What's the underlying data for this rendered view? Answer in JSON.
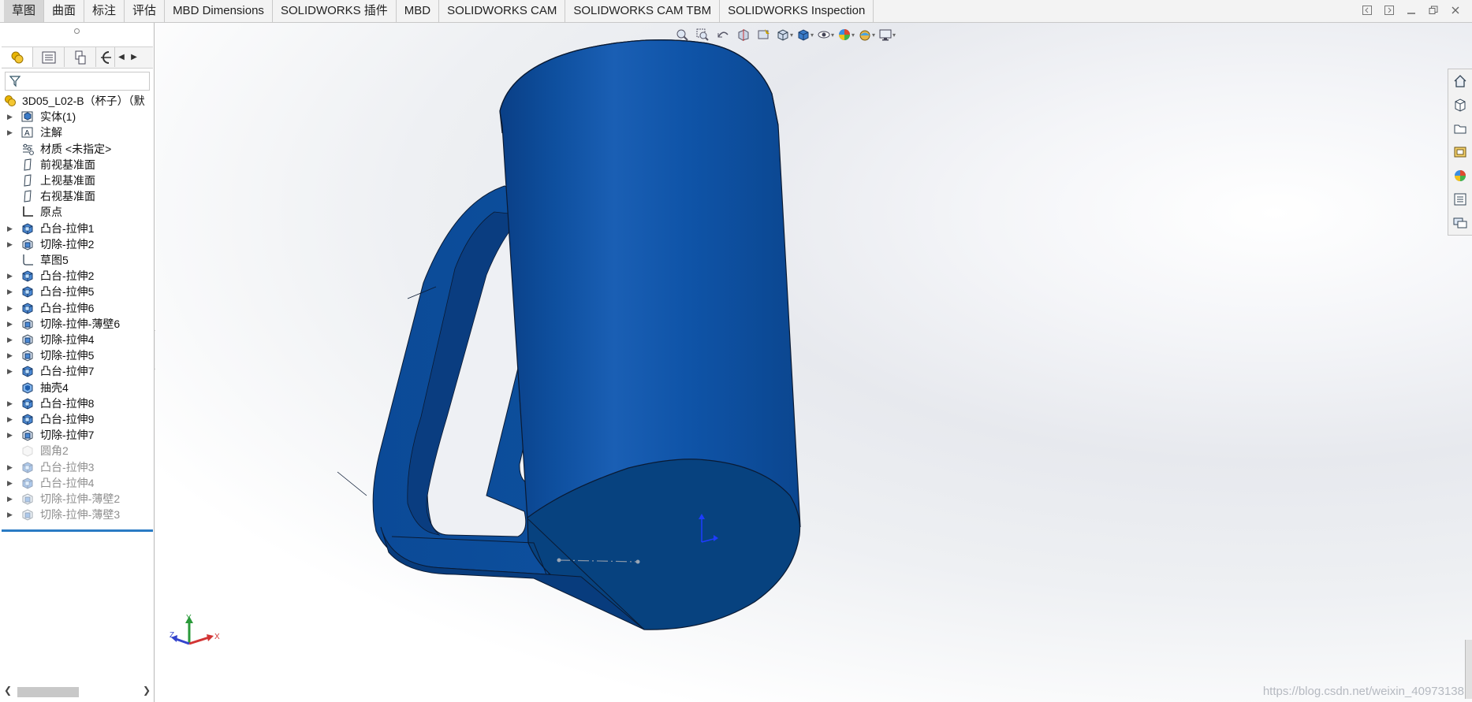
{
  "tabs": [
    {
      "label": "草图",
      "active": true
    },
    {
      "label": "曲面"
    },
    {
      "label": "标注"
    },
    {
      "label": "评估"
    },
    {
      "label": "MBD Dimensions"
    },
    {
      "label": "SOLIDWORKS 插件"
    },
    {
      "label": "MBD"
    },
    {
      "label": "SOLIDWORKS CAM"
    },
    {
      "label": "SOLIDWORKS CAM TBM"
    },
    {
      "label": "SOLIDWORKS Inspection"
    }
  ],
  "feature_tree": {
    "root": "3D05_L02-B（杯子）（默",
    "items": [
      {
        "label": "实体(1)",
        "icon": "solid-bodies-icon",
        "expandable": true
      },
      {
        "label": "注解",
        "icon": "annotations-icon",
        "expandable": true
      },
      {
        "label": "材质 <未指定>",
        "icon": "material-icon",
        "expandable": false
      },
      {
        "label": "前视基准面",
        "icon": "plane-icon",
        "expandable": false
      },
      {
        "label": "上视基准面",
        "icon": "plane-icon",
        "expandable": false
      },
      {
        "label": "右视基准面",
        "icon": "plane-icon",
        "expandable": false
      },
      {
        "label": "原点",
        "icon": "origin-icon",
        "expandable": false
      },
      {
        "label": "凸台-拉伸1",
        "icon": "boss-extrude-icon",
        "expandable": true
      },
      {
        "label": "切除-拉伸2",
        "icon": "cut-extrude-icon",
        "expandable": true
      },
      {
        "label": "草图5",
        "icon": "sketch-icon",
        "expandable": false
      },
      {
        "label": "凸台-拉伸2",
        "icon": "boss-extrude-icon",
        "expandable": true
      },
      {
        "label": "凸台-拉伸5",
        "icon": "boss-extrude-icon",
        "expandable": true
      },
      {
        "label": "凸台-拉伸6",
        "icon": "boss-extrude-icon",
        "expandable": true
      },
      {
        "label": "切除-拉伸-薄壁6",
        "icon": "cut-extrude-icon",
        "expandable": true
      },
      {
        "label": "切除-拉伸4",
        "icon": "cut-extrude-icon",
        "expandable": true
      },
      {
        "label": "切除-拉伸5",
        "icon": "cut-extrude-icon",
        "expandable": true
      },
      {
        "label": "凸台-拉伸7",
        "icon": "boss-extrude-icon",
        "expandable": true
      },
      {
        "label": "抽壳4",
        "icon": "shell-icon",
        "expandable": false
      },
      {
        "label": "凸台-拉伸8",
        "icon": "boss-extrude-icon",
        "expandable": true
      },
      {
        "label": "凸台-拉伸9",
        "icon": "boss-extrude-icon",
        "expandable": true
      },
      {
        "label": "切除-拉伸7",
        "icon": "cut-extrude-icon",
        "expandable": true
      }
    ],
    "suppressed_items": [
      {
        "label": "圆角2",
        "icon": "fillet-icon",
        "expandable": false
      },
      {
        "label": "凸台-拉伸3",
        "icon": "boss-extrude-icon",
        "expandable": true
      },
      {
        "label": "凸台-拉伸4",
        "icon": "boss-extrude-icon",
        "expandable": true
      },
      {
        "label": "切除-拉伸-薄壁2",
        "icon": "cut-extrude-icon",
        "expandable": true
      },
      {
        "label": "切除-拉伸-薄壁3",
        "icon": "cut-extrude-icon",
        "expandable": true
      }
    ]
  },
  "filter": {
    "placeholder": ""
  },
  "triad": {
    "x": "X",
    "y": "Y",
    "z": "Z"
  },
  "watermark": "https://blog.csdn.net/weixin_40973138",
  "colors": {
    "model_blue": "#0b4f9f",
    "model_dark": "#053a7e",
    "rollback_bar": "#2a7bc4"
  }
}
